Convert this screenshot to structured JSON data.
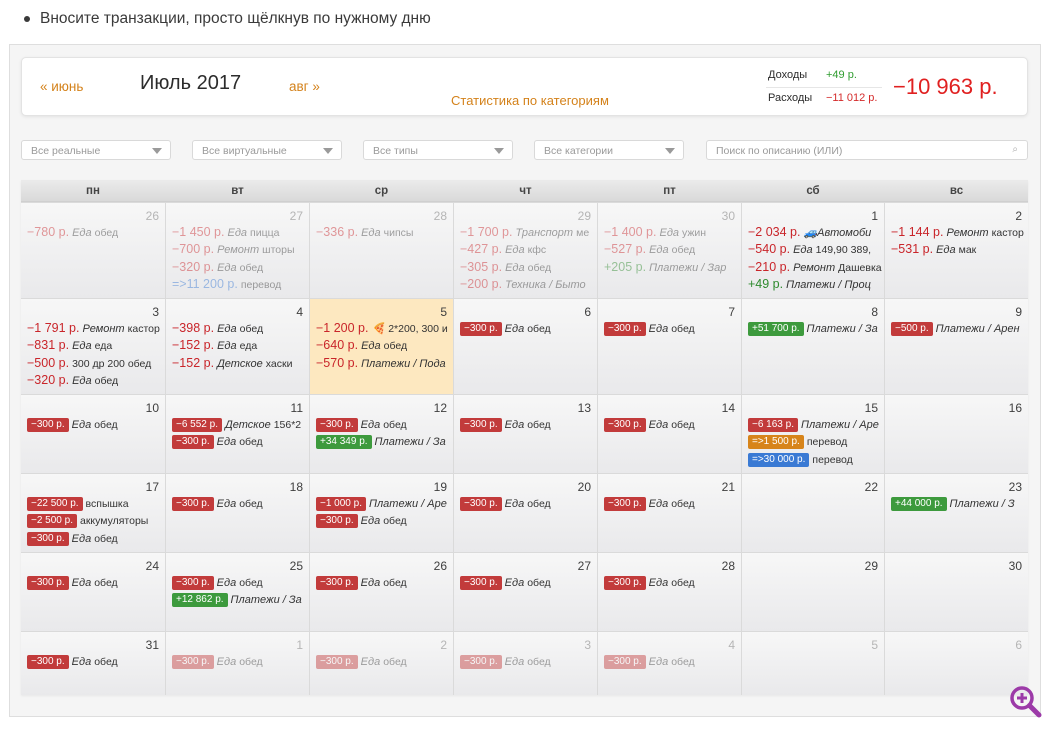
{
  "bullet": "Вносите транзакции, просто щёлкнув по нужному дню",
  "header": {
    "prev": "« июнь",
    "title": "Июль 2017",
    "next": "авг »",
    "stats_link": "Статистика по категориям",
    "income_label": "Доходы",
    "income_value": "+49 р.",
    "expense_label": "Расходы",
    "expense_value": "−11 012 р.",
    "balance": "−10 963 р."
  },
  "filters": {
    "real": "Все реальные",
    "virtual": "Все виртуальные",
    "types": "Все типы",
    "categories": "Все категории",
    "search_placeholder": "Поиск по описанию (ИЛИ)"
  },
  "weekdays": [
    "пн",
    "вт",
    "ср",
    "чт",
    "пт",
    "сб",
    "вс"
  ],
  "colors": {
    "expense": "#c9252a",
    "income": "#2e8a2e",
    "transfer": "#3a7ad4",
    "transfer_out": "#cf7a10",
    "today": "#fde8c0",
    "accent": "#d4821b"
  },
  "weeks": [
    [
      {
        "day": "26",
        "dim": true,
        "entries": [
          {
            "amount": "−780 р.",
            "kind": "e",
            "cat": "Еда",
            "desc": "обед"
          }
        ]
      },
      {
        "day": "27",
        "dim": true,
        "entries": [
          {
            "amount": "−1 450 р.",
            "kind": "e",
            "cat": "Еда",
            "desc": "пицца"
          },
          {
            "amount": "−700 р.",
            "kind": "e",
            "cat": "Ремонт",
            "desc": "шторы"
          },
          {
            "amount": "−320 р.",
            "kind": "e",
            "cat": "Еда",
            "desc": "обед"
          },
          {
            "amount": "=>11 200 р.",
            "kind": "t",
            "cat": "",
            "desc": "перевод"
          }
        ]
      },
      {
        "day": "28",
        "dim": true,
        "entries": [
          {
            "amount": "−336 р.",
            "kind": "e",
            "cat": "Еда",
            "desc": "чипсы"
          }
        ]
      },
      {
        "day": "29",
        "dim": true,
        "entries": [
          {
            "amount": "−1 700 р.",
            "kind": "e",
            "cat": "Транспорт",
            "desc": "ме"
          },
          {
            "amount": "−427 р.",
            "kind": "e",
            "cat": "Еда",
            "desc": "кфс"
          },
          {
            "amount": "−305 р.",
            "kind": "e",
            "cat": "Еда",
            "desc": "обед"
          },
          {
            "amount": "−200 р.",
            "kind": "e",
            "cat": "Техника / Быто",
            "desc": ""
          }
        ]
      },
      {
        "day": "30",
        "dim": true,
        "entries": [
          {
            "amount": "−1 400 р.",
            "kind": "e",
            "cat": "Еда",
            "desc": "ужин"
          },
          {
            "amount": "−527 р.",
            "kind": "e",
            "cat": "Еда",
            "desc": "обед"
          },
          {
            "amount": "+205 р.",
            "kind": "i",
            "cat": "Платежи / Зар",
            "desc": ""
          }
        ]
      },
      {
        "day": "1",
        "entries": [
          {
            "amount": "−2 034 р.",
            "kind": "e",
            "cat": "🚙Автомоби",
            "desc": ""
          },
          {
            "amount": "−540 р.",
            "kind": "e",
            "cat": "Еда",
            "desc": "149,90 389,"
          },
          {
            "amount": "−210 р.",
            "kind": "e",
            "cat": "Ремонт",
            "desc": "Дашевка"
          },
          {
            "amount": "+49 р.",
            "kind": "i",
            "cat": "Платежи / Проц",
            "desc": ""
          }
        ]
      },
      {
        "day": "2",
        "entries": [
          {
            "amount": "−1 144 р.",
            "kind": "e",
            "cat": "Ремонт",
            "desc": "кастор"
          },
          {
            "amount": "−531 р.",
            "kind": "e",
            "cat": "Еда",
            "desc": "мак"
          }
        ]
      }
    ],
    [
      {
        "day": "3",
        "entries": [
          {
            "amount": "−1 791 р.",
            "kind": "e",
            "cat": "Ремонт",
            "desc": "кастор"
          },
          {
            "amount": "−831 р.",
            "kind": "e",
            "cat": "Еда",
            "desc": "еда"
          },
          {
            "amount": "−500 р.",
            "kind": "e",
            "cat": "",
            "desc": "300 др 200 обед"
          },
          {
            "amount": "−320 р.",
            "kind": "e",
            "cat": "Еда",
            "desc": "обед"
          }
        ]
      },
      {
        "day": "4",
        "entries": [
          {
            "amount": "−398 р.",
            "kind": "e",
            "cat": "Еда",
            "desc": "обед"
          },
          {
            "amount": "−152 р.",
            "kind": "e",
            "cat": "Еда",
            "desc": "еда"
          },
          {
            "amount": "−152 р.",
            "kind": "e",
            "cat": "Детское",
            "desc": "хаски"
          }
        ]
      },
      {
        "day": "5",
        "today": true,
        "entries": [
          {
            "amount": "−1 200 р.",
            "kind": "e",
            "cat": "🍕",
            "desc": "2*200, 300 и"
          },
          {
            "amount": "−640 р.",
            "kind": "e",
            "cat": "Еда",
            "desc": "обед"
          },
          {
            "amount": "−570 р.",
            "kind": "e",
            "cat": "Платежи / Пода",
            "desc": ""
          }
        ]
      },
      {
        "day": "6",
        "entries": [
          {
            "amount": "−300 р.",
            "kind": "e",
            "pill": true,
            "cat": "Еда",
            "desc": "обед"
          }
        ]
      },
      {
        "day": "7",
        "entries": [
          {
            "amount": "−300 р.",
            "kind": "e",
            "pill": true,
            "cat": "Еда",
            "desc": "обед"
          }
        ]
      },
      {
        "day": "8",
        "entries": [
          {
            "amount": "+51 700 р.",
            "kind": "i",
            "pill": true,
            "cat": "Платежи / За",
            "desc": ""
          }
        ]
      },
      {
        "day": "9",
        "entries": [
          {
            "amount": "−500 р.",
            "kind": "e",
            "pill": true,
            "cat": "Платежи / Арен",
            "desc": ""
          }
        ]
      }
    ],
    [
      {
        "day": "10",
        "entries": [
          {
            "amount": "−300 р.",
            "kind": "e",
            "pill": true,
            "cat": "Еда",
            "desc": "обед"
          }
        ]
      },
      {
        "day": "11",
        "entries": [
          {
            "amount": "−6 552 р.",
            "kind": "e",
            "pill": true,
            "cat": "Детское",
            "desc": "156*2"
          },
          {
            "amount": "−300 р.",
            "kind": "e",
            "pill": true,
            "cat": "Еда",
            "desc": "обед"
          }
        ]
      },
      {
        "day": "12",
        "entries": [
          {
            "amount": "−300 р.",
            "kind": "e",
            "pill": true,
            "cat": "Еда",
            "desc": "обед"
          },
          {
            "amount": "+34 349 р.",
            "kind": "i",
            "pill": true,
            "cat": "Платежи / За",
            "desc": ""
          }
        ]
      },
      {
        "day": "13",
        "entries": [
          {
            "amount": "−300 р.",
            "kind": "e",
            "pill": true,
            "cat": "Еда",
            "desc": "обед"
          }
        ]
      },
      {
        "day": "14",
        "entries": [
          {
            "amount": "−300 р.",
            "kind": "e",
            "pill": true,
            "cat": "Еда",
            "desc": "обед"
          }
        ]
      },
      {
        "day": "15",
        "entries": [
          {
            "amount": "−6 163 р.",
            "kind": "e",
            "pill": true,
            "cat": "Платежи / Аре",
            "desc": ""
          },
          {
            "amount": "=>1 500 р.",
            "kind": "o",
            "pill": true,
            "cat": "",
            "desc": "перевод"
          },
          {
            "amount": "=>30 000 р.",
            "kind": "t",
            "pill": true,
            "cat": "",
            "desc": "перевод"
          }
        ]
      },
      {
        "day": "16",
        "entries": []
      }
    ],
    [
      {
        "day": "17",
        "entries": [
          {
            "amount": "−22 500 р.",
            "kind": "e",
            "pill": true,
            "cat": "",
            "desc": "вспышка"
          },
          {
            "amount": "−2 500 р.",
            "kind": "e",
            "pill": true,
            "cat": "",
            "desc": "аккумуляторы"
          },
          {
            "amount": "−300 р.",
            "kind": "e",
            "pill": true,
            "cat": "Еда",
            "desc": "обед"
          }
        ]
      },
      {
        "day": "18",
        "entries": [
          {
            "amount": "−300 р.",
            "kind": "e",
            "pill": true,
            "cat": "Еда",
            "desc": "обед"
          }
        ]
      },
      {
        "day": "19",
        "entries": [
          {
            "amount": "−1 000 р.",
            "kind": "e",
            "pill": true,
            "cat": "Платежи / Аре",
            "desc": ""
          },
          {
            "amount": "−300 р.",
            "kind": "e",
            "pill": true,
            "cat": "Еда",
            "desc": "обед"
          }
        ]
      },
      {
        "day": "20",
        "entries": [
          {
            "amount": "−300 р.",
            "kind": "e",
            "pill": true,
            "cat": "Еда",
            "desc": "обед"
          }
        ]
      },
      {
        "day": "21",
        "entries": [
          {
            "amount": "−300 р.",
            "kind": "e",
            "pill": true,
            "cat": "Еда",
            "desc": "обед"
          }
        ]
      },
      {
        "day": "22",
        "entries": []
      },
      {
        "day": "23",
        "entries": [
          {
            "amount": "+44 000 р.",
            "kind": "i",
            "pill": true,
            "cat": "Платежи / З",
            "desc": ""
          }
        ]
      }
    ],
    [
      {
        "day": "24",
        "entries": [
          {
            "amount": "−300 р.",
            "kind": "e",
            "pill": true,
            "cat": "Еда",
            "desc": "обед"
          }
        ]
      },
      {
        "day": "25",
        "entries": [
          {
            "amount": "−300 р.",
            "kind": "e",
            "pill": true,
            "cat": "Еда",
            "desc": "обед"
          },
          {
            "amount": "+12 862 р.",
            "kind": "i",
            "pill": true,
            "cat": "Платежи / За",
            "desc": ""
          }
        ]
      },
      {
        "day": "26",
        "entries": [
          {
            "amount": "−300 р.",
            "kind": "e",
            "pill": true,
            "cat": "Еда",
            "desc": "обед"
          }
        ]
      },
      {
        "day": "27",
        "entries": [
          {
            "amount": "−300 р.",
            "kind": "e",
            "pill": true,
            "cat": "Еда",
            "desc": "обед"
          }
        ]
      },
      {
        "day": "28",
        "entries": [
          {
            "amount": "−300 р.",
            "kind": "e",
            "pill": true,
            "cat": "Еда",
            "desc": "обед"
          }
        ]
      },
      {
        "day": "29",
        "entries": []
      },
      {
        "day": "30",
        "entries": []
      }
    ],
    [
      {
        "day": "31",
        "entries": [
          {
            "amount": "−300 р.",
            "kind": "e",
            "pill": true,
            "cat": "Еда",
            "desc": "обед"
          }
        ]
      },
      {
        "day": "1",
        "dim": true,
        "entries": [
          {
            "amount": "−300 р.",
            "kind": "e",
            "pill": true,
            "cat": "Еда",
            "desc": "обед"
          }
        ]
      },
      {
        "day": "2",
        "dim": true,
        "entries": [
          {
            "amount": "−300 р.",
            "kind": "e",
            "pill": true,
            "cat": "Еда",
            "desc": "обед"
          }
        ]
      },
      {
        "day": "3",
        "dim": true,
        "entries": [
          {
            "amount": "−300 р.",
            "kind": "e",
            "pill": true,
            "cat": "Еда",
            "desc": "обед"
          }
        ]
      },
      {
        "day": "4",
        "dim": true,
        "entries": [
          {
            "amount": "−300 р.",
            "kind": "e",
            "pill": true,
            "cat": "Еда",
            "desc": "обед"
          }
        ]
      },
      {
        "day": "5",
        "dim": true,
        "entries": []
      },
      {
        "day": "6",
        "dim": true,
        "entries": []
      }
    ]
  ]
}
